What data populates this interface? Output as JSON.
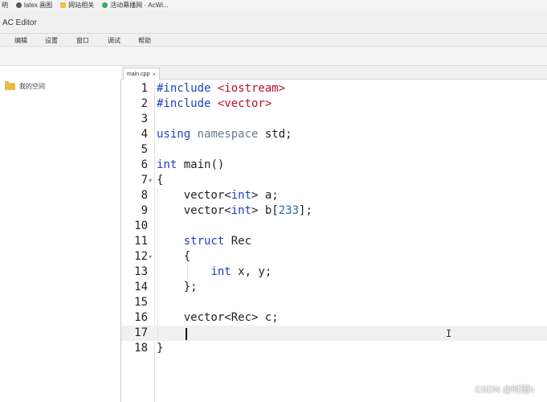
{
  "bookmarks": [
    {
      "label": "明",
      "icon": "none"
    },
    {
      "label": "latex 画图",
      "icon": "github-icon"
    },
    {
      "label": "网站相关",
      "icon": "folder-icon"
    },
    {
      "label": "活动幕播网 · AcWi...",
      "icon": "acwing-icon"
    }
  ],
  "window": {
    "title": "AC Editor"
  },
  "menu": [
    "编辑",
    "设置",
    "窗口",
    "调试",
    "帮助"
  ],
  "sidebar": {
    "items": [
      {
        "label": "我的空间",
        "icon": "folder-icon"
      }
    ]
  },
  "tabs": [
    {
      "label": "main.cpp",
      "close": "×"
    }
  ],
  "editor": {
    "active_line": 17,
    "lines": [
      {
        "n": "1",
        "fold": "",
        "tokens": [
          {
            "t": "#include ",
            "c": "k"
          },
          {
            "t": "<iostream>",
            "c": "s"
          }
        ]
      },
      {
        "n": "2",
        "fold": "",
        "tokens": [
          {
            "t": "#include ",
            "c": "k"
          },
          {
            "t": "<vector>",
            "c": "s"
          }
        ]
      },
      {
        "n": "3",
        "fold": "",
        "tokens": []
      },
      {
        "n": "4",
        "fold": "",
        "tokens": [
          {
            "t": "using",
            "c": "k"
          },
          {
            "t": " ",
            "c": ""
          },
          {
            "t": "namespace",
            "c": "n"
          },
          {
            "t": " std;",
            "c": ""
          }
        ]
      },
      {
        "n": "5",
        "fold": "",
        "tokens": []
      },
      {
        "n": "6",
        "fold": "",
        "tokens": [
          {
            "t": "int",
            "c": "k"
          },
          {
            "t": " main()",
            "c": ""
          }
        ]
      },
      {
        "n": "7",
        "fold": "▾",
        "tokens": [
          {
            "t": "{",
            "c": ""
          }
        ]
      },
      {
        "n": "8",
        "fold": "",
        "tokens": [
          {
            "t": "    vector<",
            "c": ""
          },
          {
            "t": "int",
            "c": "k"
          },
          {
            "t": "> a;",
            "c": ""
          }
        ]
      },
      {
        "n": "9",
        "fold": "",
        "tokens": [
          {
            "t": "    vector<",
            "c": ""
          },
          {
            "t": "int",
            "c": "k"
          },
          {
            "t": "> b[",
            "c": ""
          },
          {
            "t": "233",
            "c": "num"
          },
          {
            "t": "];",
            "c": ""
          }
        ]
      },
      {
        "n": "10",
        "fold": "",
        "tokens": []
      },
      {
        "n": "11",
        "fold": "",
        "tokens": [
          {
            "t": "    ",
            "c": ""
          },
          {
            "t": "struct",
            "c": "k"
          },
          {
            "t": " Rec",
            "c": ""
          }
        ]
      },
      {
        "n": "12",
        "fold": "▾",
        "tokens": [
          {
            "t": "    {",
            "c": ""
          }
        ]
      },
      {
        "n": "13",
        "fold": "",
        "tokens": [
          {
            "t": "        ",
            "c": ""
          },
          {
            "t": "int",
            "c": "k"
          },
          {
            "t": " x, y;",
            "c": ""
          }
        ]
      },
      {
        "n": "14",
        "fold": "",
        "tokens": [
          {
            "t": "    };",
            "c": ""
          }
        ]
      },
      {
        "n": "15",
        "fold": "",
        "tokens": []
      },
      {
        "n": "16",
        "fold": "",
        "tokens": [
          {
            "t": "    vector<Rec> c;",
            "c": ""
          }
        ]
      },
      {
        "n": "17",
        "fold": "",
        "tokens": []
      },
      {
        "n": "18",
        "fold": "",
        "tokens": [
          {
            "t": "}",
            "c": ""
          }
        ]
      }
    ]
  },
  "watermark": "CSDN @时雨h"
}
